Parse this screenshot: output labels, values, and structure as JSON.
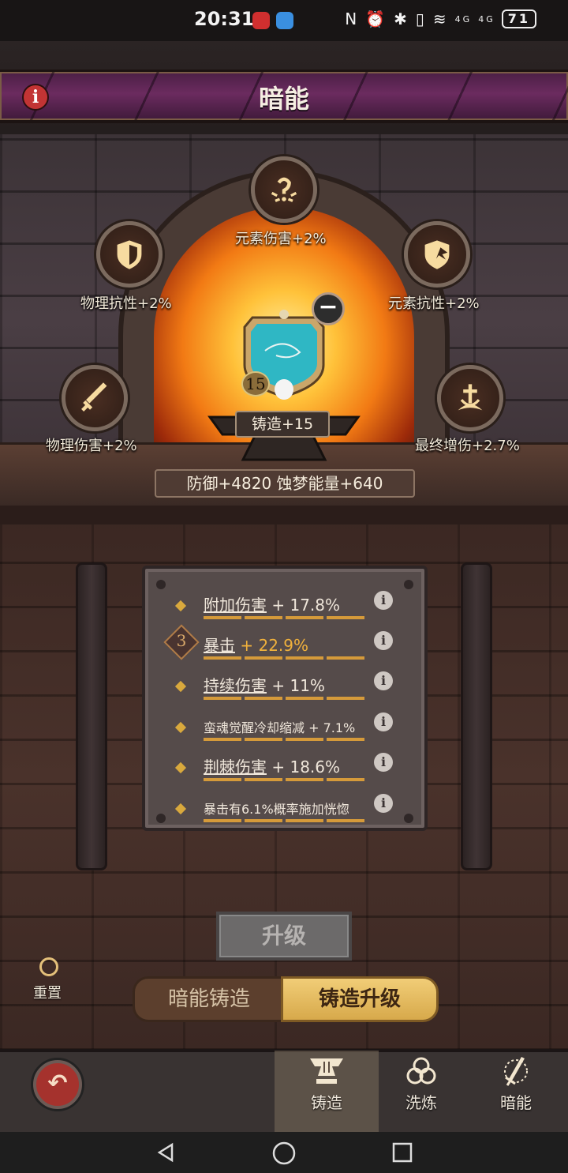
{
  "status_bar": {
    "time": "20:31",
    "battery": "71",
    "signal_labels": [
      "4G",
      "4G"
    ]
  },
  "header": {
    "title": "暗能",
    "info_icon": "i"
  },
  "forge": {
    "attributes": [
      {
        "id": "element-damage",
        "label": "元素伤害+2%",
        "icon": "element-damage-icon"
      },
      {
        "id": "physical-resist",
        "label": "物理抗性+2%",
        "icon": "shield-icon"
      },
      {
        "id": "element-resist",
        "label": "元素抗性+2%",
        "icon": "element-shield-icon"
      },
      {
        "id": "physical-damage",
        "label": "物理伤害+2%",
        "icon": "sword-icon"
      },
      {
        "id": "final-damage",
        "label": "最终增伤+2.7%",
        "icon": "burst-icon"
      }
    ],
    "gem_level": "15",
    "forge_label": "铸造+15",
    "remove_symbol": "−",
    "stats_summary": "防御+4820    蚀梦能量+640"
  },
  "bonus_stats": [
    {
      "name": "附加伤害",
      "value": " + 17.8%",
      "rank": "",
      "highlight": false,
      "small": false
    },
    {
      "name": "暴击",
      "value": " + 22.9%",
      "rank": "3",
      "highlight": true,
      "small": false
    },
    {
      "name": "持续伤害",
      "value": " + 11%",
      "rank": "",
      "highlight": false,
      "small": false
    },
    {
      "name": "",
      "value": "蛮魂觉醒冷却缩减 + 7.1%",
      "rank": "",
      "highlight": false,
      "small": true
    },
    {
      "name": "荆棘伤害",
      "value": " + 18.6%",
      "rank": "",
      "highlight": false,
      "small": false
    },
    {
      "name": "",
      "value": "暴击有6.1%概率施加恍惚",
      "rank": "",
      "highlight": false,
      "small": true
    }
  ],
  "actions": {
    "upgrade_label": "升级",
    "reset_label": "重置",
    "tab_dark_forge": "暗能铸造",
    "tab_forge_upgrade": "铸造升级"
  },
  "bottom_nav": {
    "items": [
      {
        "label": "铸造",
        "icon": "anvil-icon",
        "active": true
      },
      {
        "label": "洗炼",
        "icon": "triquetra-icon",
        "active": false
      },
      {
        "label": "暗能",
        "icon": "dark-sword-icon",
        "active": false
      }
    ]
  },
  "colors": {
    "title_bar": "#6b2b5f",
    "accent_gold": "#f0b13c",
    "fire": "#f27a14",
    "upgrade_disabled": "#6c6a6a"
  }
}
